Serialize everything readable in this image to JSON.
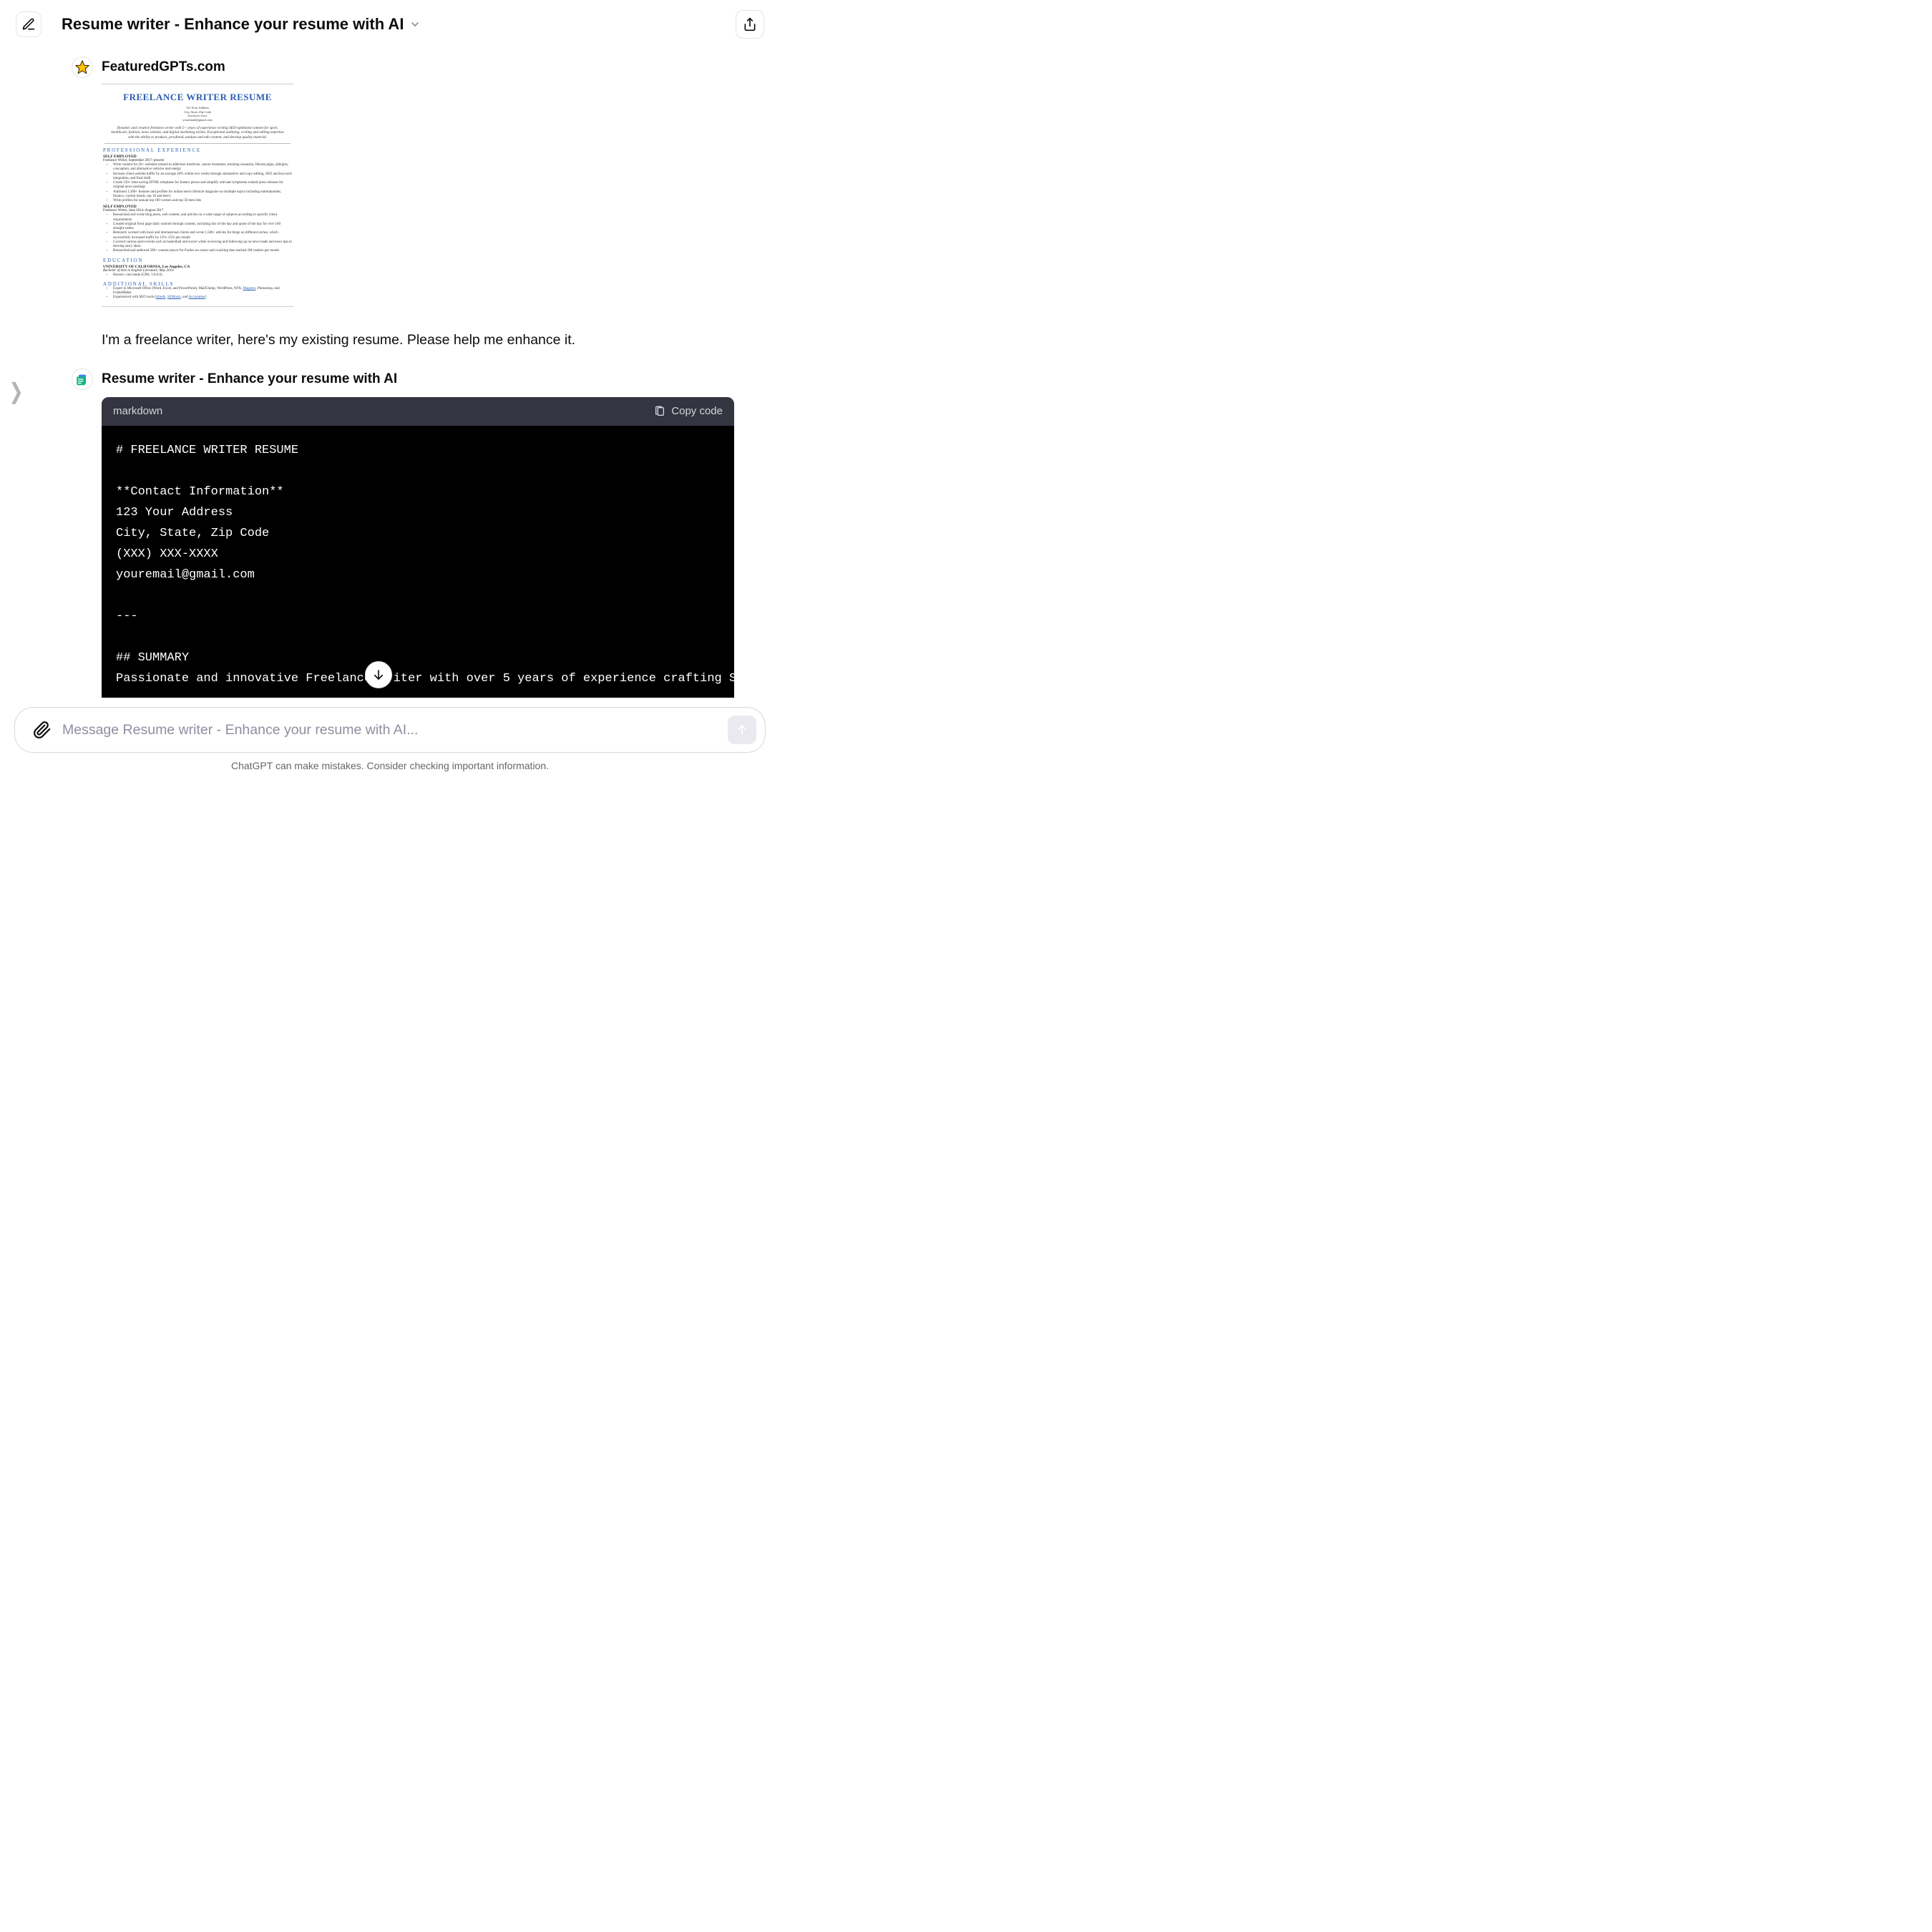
{
  "header": {
    "title": "Resume writer - Enhance your resume with AI"
  },
  "sender": {
    "name": "FeaturedGPTs.com",
    "message": "I'm a freelance writer, here's my existing resume. Please help me enhance it."
  },
  "resume_preview": {
    "title": "FREELANCE WRITER RESUME",
    "contact_l1": "123 Your Address",
    "contact_l2": "City, State, Zip Code",
    "contact_l3": "(xxx)xxx-xxxx",
    "contact_l4": "youremail@gmail.com",
    "summary": "Dynamic and creative freelance writer with 5+ years of experience writing SEO-optimized content for sport, healthcare, fashion, news website, and digital marketing niches. Exceptional outlining, writing and editing expertise with the ability to produce, proofread, analyze and edit content, and develop quality material.",
    "sec_prof": "PROFESSIONAL EXPERIENCE",
    "job1_h": "SELF EMPLOYED",
    "job1_sub": "Freelance Writer, September 2017–present",
    "job1_bullets": [
      "Write content for 20+ websites related to addiction medicine, cancer treatment, smoking cessation, fibromyalgia, allergies, conception, and alternative vehicles and energy",
      "Increase client website traffic by an average 26% within two weeks through substantive and copy-editing, SEO and keyword integration, and final draft",
      "Create 150+ time-saving HTML templates for feature pieces and simplify relevant lymphoma related press releases for original news postings",
      "Authored 1,500+ features and profiles for online men's lifestyle magazine on multiple topics including entertainment, finance, current trends, top 10 and best's",
      "Write profiles for annual top 100 women and top 50 men lists"
    ],
    "job2_h": "SELF EMPLOYED",
    "job2_sub": "Freelance Writer, June 2014–August 2017",
    "job2_bullets": [
      "Researched and wrote blog posts, web content, and articles on a wide range of subjects according to specific client requirements",
      "Created original front page daily outlook through content, including fact of the day and quote of the day for over 160 straight weeks",
      "Remotely worked with local and international clients and wrote 1,500+ articles for blogs on different niches, which successfully increased traffic by 15%–25% per month",
      "Covered various sport events such as basketball and soccer while reviewing and following up on news leads and news tips to develop story ideas",
      "Researched and authored 500+ content pieces for Forbes on career and coaching that reached 2M readers per month"
    ],
    "sec_edu": "EDUCATION",
    "edu_h": "UNIVERSITY OF CALIFORNIA, Los Angeles, CA",
    "edu_sub": "Bachelor of Arts in English Literature, May 2014",
    "edu_bullet": "Honors: cum laude (GPA: 3.6/4.0)",
    "sec_skills": "ADDITIONAL SKILLS",
    "skills_bullets_pre": "Expert in Microsoft Office (Word, Excel, and PowerPoint), MailChimp, WordPress, WIX, ",
    "skills_link1": "Magento",
    "skills_bullets_mid": ", Photoshop, and FrameMaker",
    "skills_b2_pre": "Experienced with SEO tools (",
    "skills_b2_l1": "Ahrefs",
    "skills_b2_m1": ", ",
    "skills_b2_l2": "SEMrush",
    "skills_b2_m2": ", and ",
    "skills_b2_l3": "Accuranker",
    "skills_b2_post": ")"
  },
  "assistant": {
    "name": "Resume writer - Enhance your resume with AI",
    "code_lang": "markdown",
    "copy_label": "Copy code",
    "code": "# FREELANCE WRITER RESUME\n\n**Contact Information**\n123 Your Address\nCity, State, Zip Code\n(XXX) XXX-XXXX\nyouremail@gmail.com\n\n---\n\n## SUMMARY\nPassionate and innovative Freelance Writer with over 5 years of experience crafting SEO-optimized content across diverse niches including sports, healthcare, fashion, news, and digital marketing.\n\n---"
  },
  "composer": {
    "placeholder": "Message Resume writer - Enhance your resume with AI..."
  },
  "footer": "ChatGPT can make mistakes. Consider checking important information."
}
